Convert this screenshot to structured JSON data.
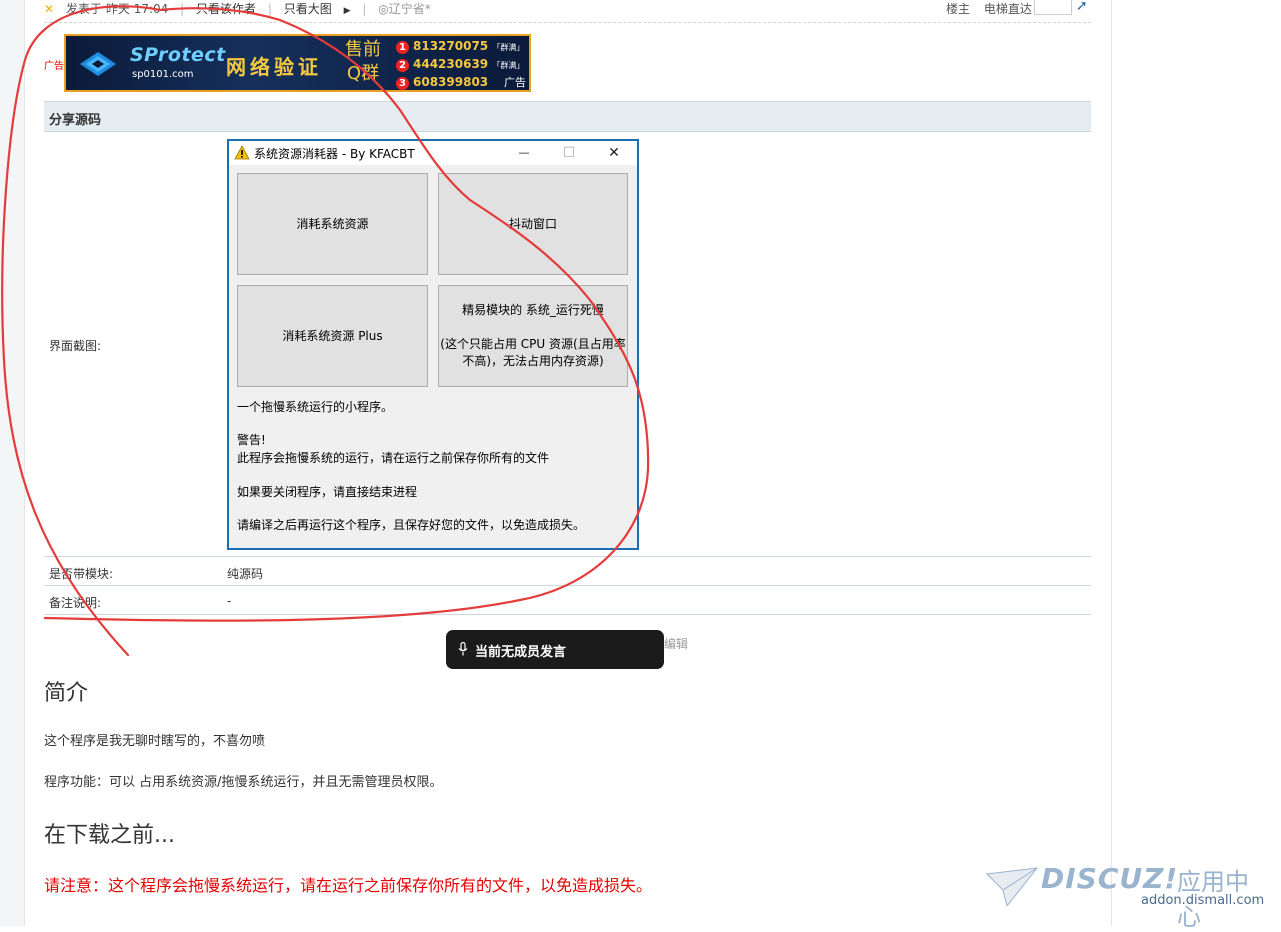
{
  "meta": {
    "posted_prefix": "发表于",
    "posted_time": "昨天 17:04",
    "only_author": "只看该作者",
    "only_images": "只看大图",
    "location": "辽宁省*"
  },
  "meta_right": {
    "floor": "楼主",
    "jump": "电梯直达"
  },
  "ad": {
    "tag": "广告",
    "brand": "SProtect",
    "site": "sp0101.com",
    "slogan": "网络验证",
    "sale_top": "售前",
    "sale_bottom": "Q群",
    "qq": [
      {
        "num": "1",
        "value": "813270075",
        "note": "「群满」"
      },
      {
        "num": "2",
        "value": "444230639",
        "note": "「群满」"
      },
      {
        "num": "3",
        "value": "608399803",
        "note": ""
      }
    ],
    "label": "广告"
  },
  "section": {
    "title": "分享源码",
    "screenshot_label": "界面截图:",
    "module_label": "是否带模块:",
    "module_value": "纯源码",
    "remark_label": "备注说明:",
    "remark_value": "-"
  },
  "window": {
    "title": "系统资源消耗器 - By KFACBT",
    "minimize": "—",
    "maximize": "☐",
    "close": "✕",
    "btn1": "消耗系统资源",
    "btn2": "抖动窗口",
    "btn3": "消耗系统资源 Plus",
    "btn4_line1": "精易模块的 系统_运行死慢",
    "btn4_line2": "(这个只能占用 CPU 资源(且占用率",
    "btn4_line3": "不高)，无法占用内存资源)",
    "text1": "一个拖慢系统运行的小程序。",
    "text2": "警告!",
    "text3": "此程序会拖慢系统的运行，请在运行之前保存你所有的文件",
    "text4": "如果要关闭程序，请直接结束进程",
    "text5": "请编译之后再运行这个程序，且保存好您的文件，以免造成损失。"
  },
  "toast": {
    "text": "当前无成员发言"
  },
  "edit_hint": "编辑",
  "content": {
    "h_intro": "简介",
    "p1": "这个程序是我无聊时瞎写的，不喜勿喷",
    "p2": "程序功能：可以 占用系统资源/拖慢系统运行，并且无需管理员权限。",
    "h_before": "在下载之前...",
    "warning": "请注意：这个程序会拖慢系统运行，请在运行之前保存你所有的文件，以免造成损失。"
  },
  "watermark": {
    "brand": "DISCUZ!",
    "cn": "应用中心",
    "url": "addon.dismall.com"
  },
  "colors": {
    "annotation": "#e53b3b",
    "window_border": "#1a6fb3",
    "warning_text": "#e60000"
  }
}
